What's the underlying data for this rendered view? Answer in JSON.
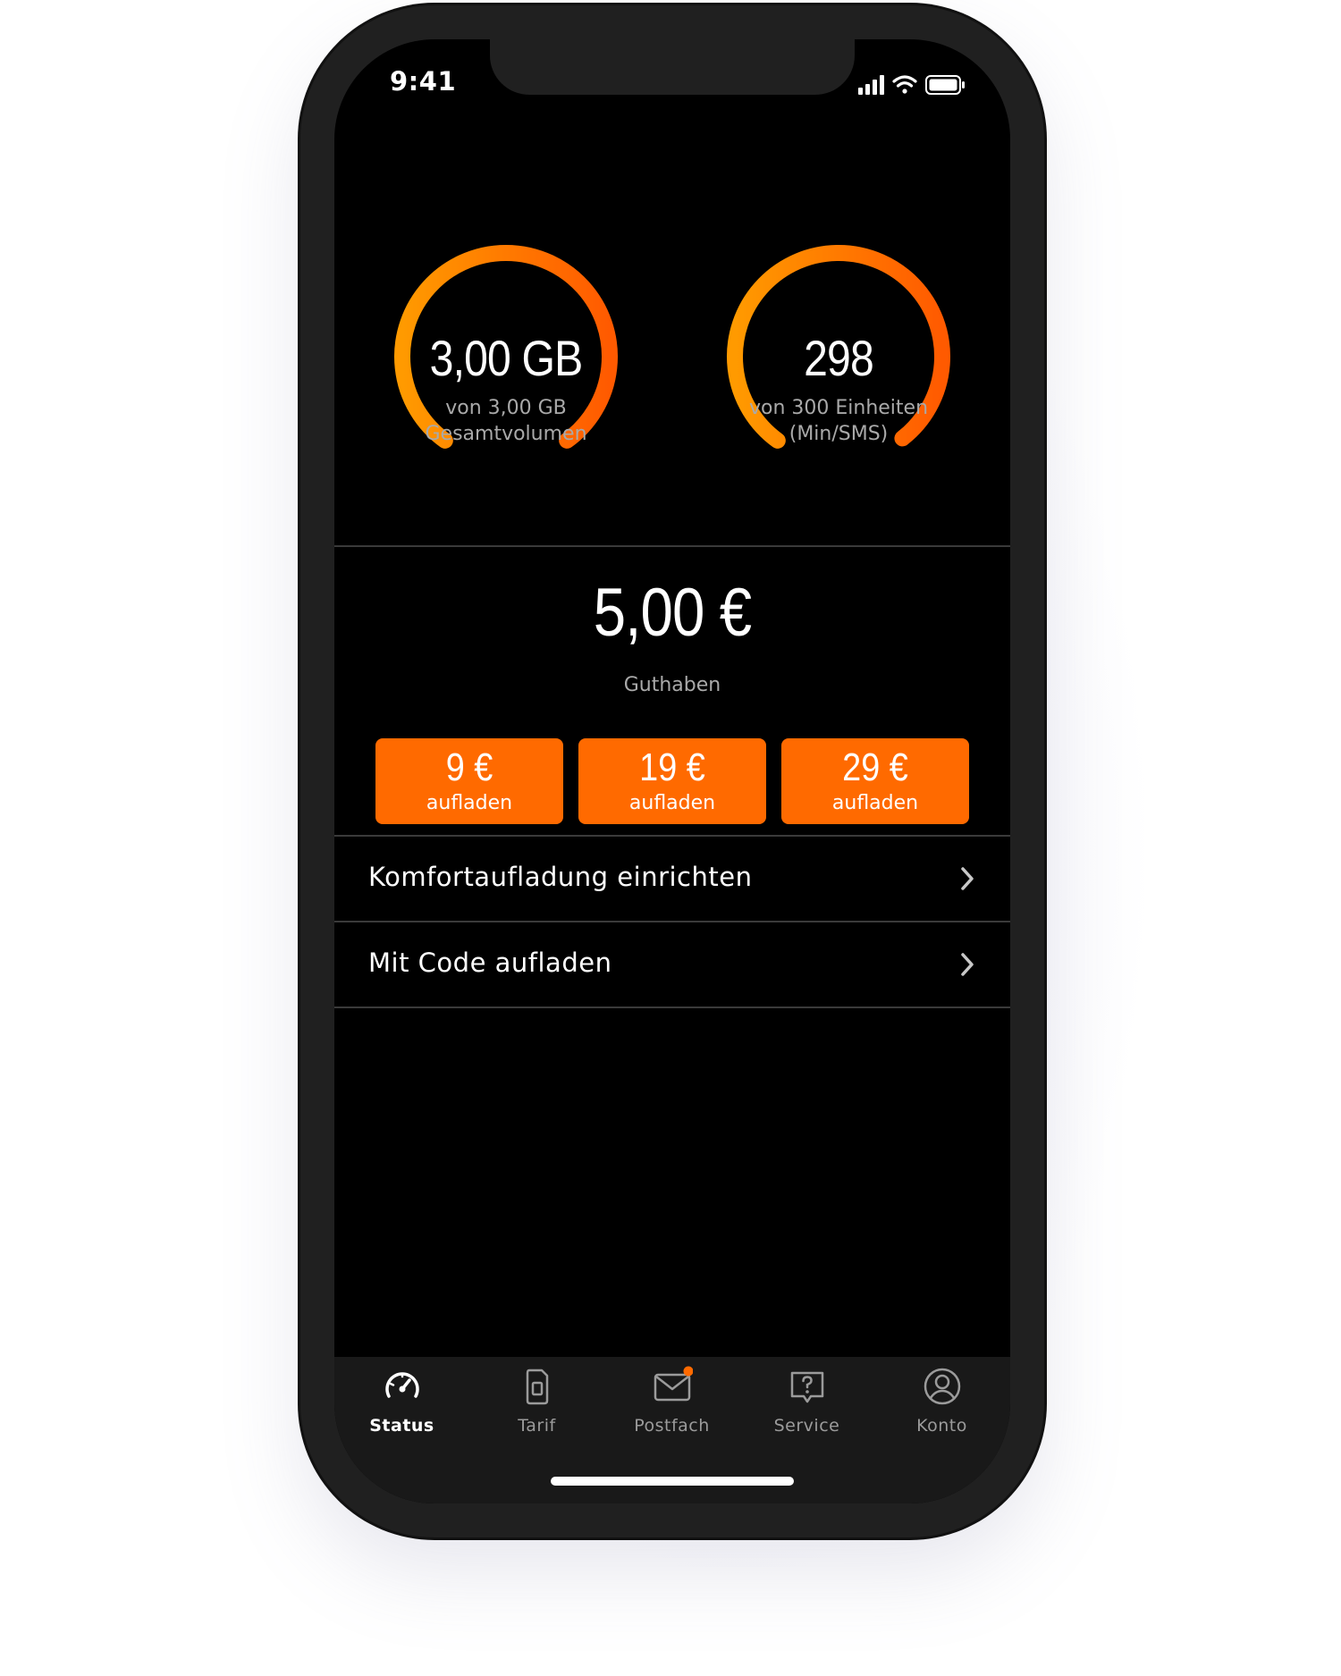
{
  "status_bar": {
    "time": "9:41",
    "icons": [
      "cellular-signal-icon",
      "wifi-icon",
      "battery-icon"
    ]
  },
  "gauges": [
    {
      "value": "3,00 GB",
      "subtitle_line1": "von 3,00 GB",
      "subtitle_line2": "Gesamtvolumen",
      "fill_fraction": 1.0
    },
    {
      "value": "298",
      "subtitle_line1": "von 300 Einheiten",
      "subtitle_line2": "(Min/SMS)",
      "fill_fraction": 0.993
    }
  ],
  "balance": {
    "value": "5,00 €",
    "label": "Guthaben"
  },
  "topups": [
    {
      "amount": "9 €",
      "label": "aufladen"
    },
    {
      "amount": "19 €",
      "label": "aufladen"
    },
    {
      "amount": "29 €",
      "label": "aufladen"
    }
  ],
  "list_items": [
    {
      "label": "Komfortaufladung einrichten"
    },
    {
      "label": "Mit Code aufladen"
    }
  ],
  "tabs": [
    {
      "label": "Status",
      "icon": "speedometer-icon",
      "active": true
    },
    {
      "label": "Tarif",
      "icon": "sim-card-icon",
      "active": false
    },
    {
      "label": "Postfach",
      "icon": "mail-icon",
      "active": false,
      "badge": true
    },
    {
      "label": "Service",
      "icon": "help-bubble-icon",
      "active": false
    },
    {
      "label": "Konto",
      "icon": "account-icon",
      "active": false
    }
  ],
  "colors": {
    "accent": "#ff6a00",
    "gauge_gradient_start": "#ff9a00",
    "gauge_gradient_end": "#ff5a00",
    "background": "#000000",
    "tabbar": "#191919",
    "badge": "#ff6a00"
  }
}
